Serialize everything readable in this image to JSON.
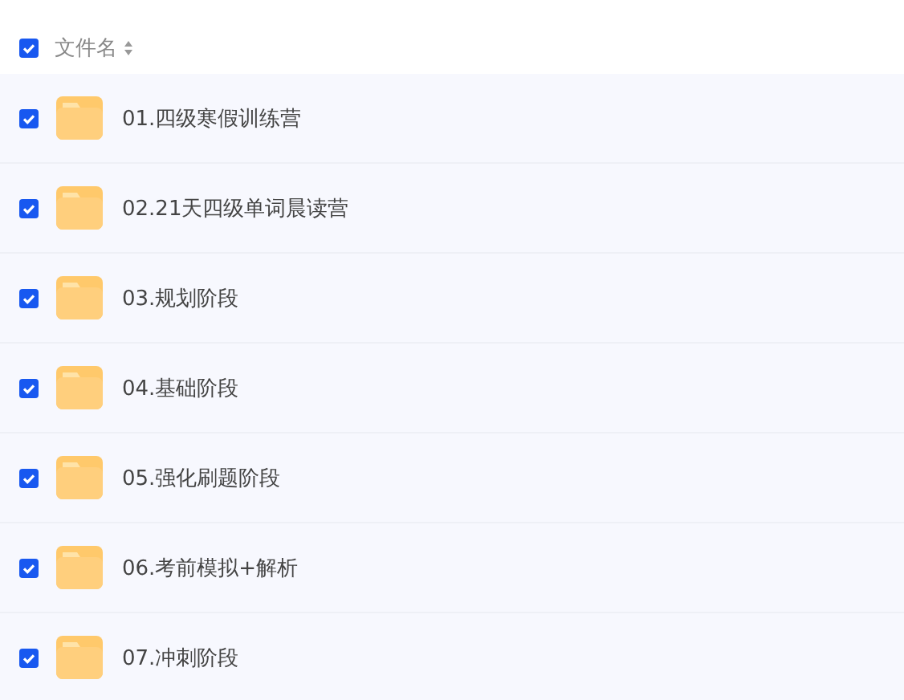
{
  "header": {
    "checked": true,
    "column_label": "文件名"
  },
  "rows": [
    {
      "name": "01.四级寒假训练营",
      "checked": true
    },
    {
      "name": "02.21天四级单词晨读营",
      "checked": true
    },
    {
      "name": "03.规划阶段",
      "checked": true
    },
    {
      "name": "04.基础阶段",
      "checked": true
    },
    {
      "name": "05.强化刷题阶段",
      "checked": true
    },
    {
      "name": "06.考前模拟+解析",
      "checked": true
    },
    {
      "name": "07.冲刺阶段",
      "checked": true
    }
  ]
}
